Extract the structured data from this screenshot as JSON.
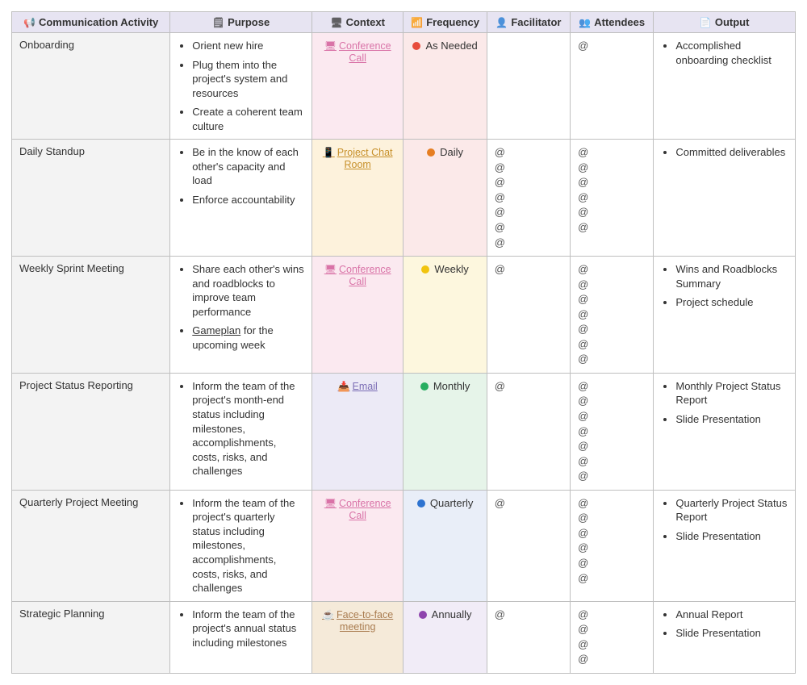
{
  "headers": {
    "activity": "Communication Activity",
    "purpose": "Purpose",
    "context": "Context",
    "frequency": "Frequency",
    "facilitator": "Facilitator",
    "attendees": "Attendees",
    "output": "Output"
  },
  "header_icons": {
    "activity": "📢",
    "purpose": "🗒",
    "context": "🖥",
    "frequency": "📶",
    "facilitator": "👤",
    "attendees": "👥",
    "output": "📄"
  },
  "rows": [
    {
      "activity": "Onboarding",
      "purpose": [
        "Orient new hire",
        "Plug them into the project's system and resources",
        "Create a coherent team culture"
      ],
      "context": {
        "label": "Conference Call",
        "icon": "🖥",
        "bg": "ctx-pink",
        "link_cls": "pink"
      },
      "frequency": {
        "label": "As Needed",
        "bg": "freq-red",
        "dot": "dot-red"
      },
      "facilitator": 0,
      "attendees": 1,
      "output": [
        "Accomplished onboarding checklist"
      ]
    },
    {
      "activity": "Daily Standup",
      "purpose": [
        "Be in the know of each other's capacity and load",
        "Enforce accountability"
      ],
      "context": {
        "label": "Project Chat Room",
        "icon": "📱",
        "bg": "ctx-amber",
        "link_cls": "amber"
      },
      "frequency": {
        "label": "Daily",
        "bg": "freq-red",
        "dot": "dot-orange"
      },
      "facilitator": 7,
      "attendees": 6,
      "output": [
        "Committed deliverables"
      ]
    },
    {
      "activity": "Weekly Sprint Meeting",
      "purpose": [
        "Share each other's wins and roadblocks to improve team performance",
        "<u>Gameplan</u> for the upcoming week"
      ],
      "context": {
        "label": "Conference Call",
        "icon": "🖥",
        "bg": "ctx-pink",
        "link_cls": "pink"
      },
      "frequency": {
        "label": "Weekly",
        "bg": "freq-yellow",
        "dot": "dot-yellow"
      },
      "facilitator": 1,
      "attendees": 7,
      "output": [
        "Wins and Roadblocks Summary",
        "Project schedule"
      ]
    },
    {
      "activity": "Project Status Reporting",
      "purpose": [
        "Inform the team of the project's month-end status including milestones, accomplishments, costs, risks, and challenges"
      ],
      "context": {
        "label": "Email",
        "icon": "📥",
        "bg": "ctx-violet",
        "link_cls": "violet"
      },
      "frequency": {
        "label": "Monthly",
        "bg": "freq-green",
        "dot": "dot-green"
      },
      "facilitator": 1,
      "attendees": 7,
      "output": [
        "Monthly Project Status Report",
        "Slide Presentation"
      ]
    },
    {
      "activity": "Quarterly Project Meeting",
      "purpose": [
        "Inform the team of the project's quarterly status including milestones, accomplishments, costs, risks, and challenges"
      ],
      "context": {
        "label": "Conference Call",
        "icon": "🖥",
        "bg": "ctx-pink",
        "link_cls": "pink"
      },
      "frequency": {
        "label": "Quarterly",
        "bg": "freq-blue",
        "dot": "dot-blue"
      },
      "facilitator": 1,
      "attendees": 6,
      "output": [
        "Quarterly Project Status Report",
        "Slide Presentation"
      ]
    },
    {
      "activity": "Strategic Planning",
      "purpose": [
        "Inform the team of the project's annual status including milestones"
      ],
      "context": {
        "label": "Face-to-face meeting",
        "icon": "☕",
        "bg": "ctx-tan",
        "link_cls": "tan"
      },
      "frequency": {
        "label": "Annually",
        "bg": "freq-lav",
        "dot": "dot-purple"
      },
      "facilitator": 1,
      "attendees": 4,
      "output": [
        "Annual Report",
        "Slide Presentation"
      ]
    }
  ],
  "mention_glyph": "@"
}
